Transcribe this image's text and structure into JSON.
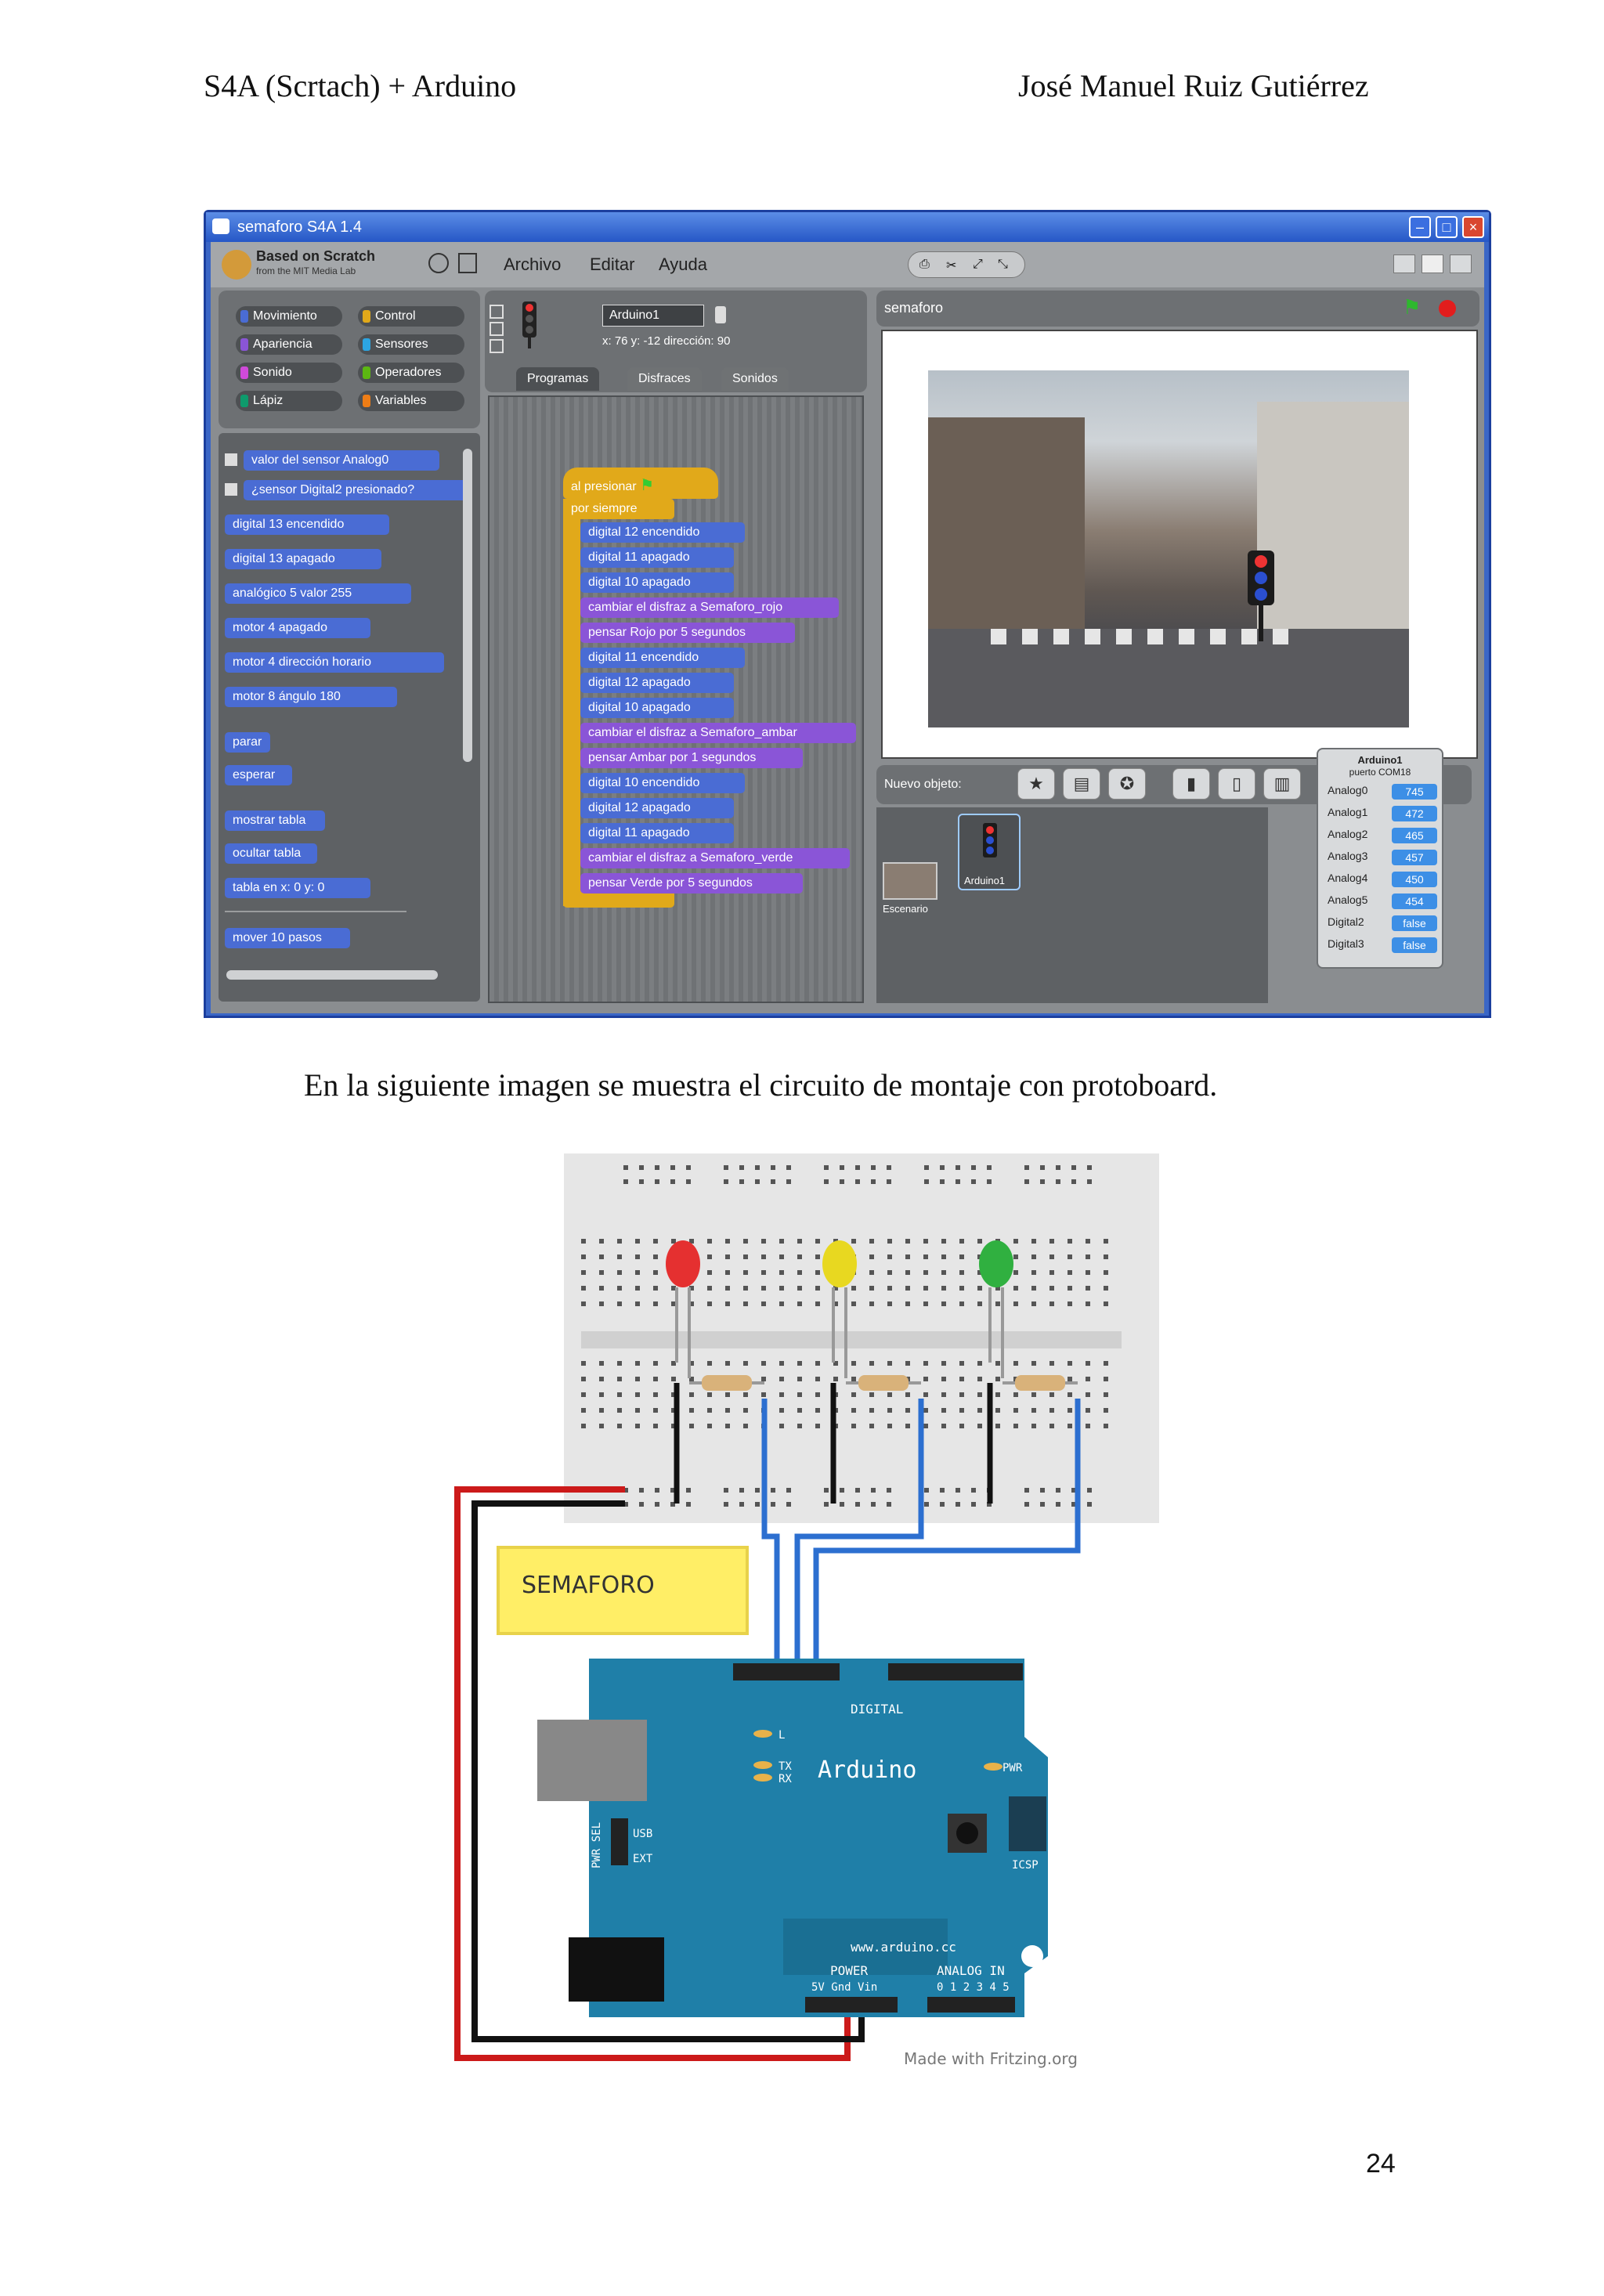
{
  "header": {
    "left": "S4A (Scrtach) + Arduino",
    "right": "José Manuel Ruiz Gutiérrez"
  },
  "page_number": "24",
  "caption": "En la siguiente imagen se muestra el circuito de montaje con protoboard.",
  "s4a_window": {
    "title": "semaforo  S4A 1.4",
    "logo_line1": "Based on Scratch",
    "logo_line2": "from the MIT Media Lab",
    "menu": [
      "Archivo",
      "Editar",
      "Ayuda"
    ],
    "categories": [
      "Movimiento",
      "Control",
      "Apariencia",
      "Sensores",
      "Sonido",
      "Operadores",
      "Lápiz",
      "Variables"
    ],
    "sprite_name": "Arduino1",
    "sprite_coords": "x: 76   y: -12   dirección: 90",
    "tabs": [
      "Programas",
      "Disfraces",
      "Sonidos"
    ],
    "stage_name": "semaforo",
    "sprite_bar_label": "Nuevo objeto:",
    "sprite_thumbs": [
      "Escenario",
      "Arduino1"
    ],
    "palette_blocks": [
      "valor del sensor Analog0",
      "¿sensor Digital2 presionado?",
      "digital 13 encendido",
      "digital 13 apagado",
      "analógico 5 valor 255",
      "motor 4 apagado",
      "motor 4 dirección horario",
      "motor 8 ángulo 180",
      "parar",
      "esperar",
      "mostrar tabla",
      "ocultar tabla",
      "tabla en x: 0 y: 0",
      "mover 10 pasos"
    ],
    "script": [
      "al presionar",
      "por siempre",
      "digital 12 encendido",
      "digital 11 apagado",
      "digital 10 apagado",
      "cambiar el disfraz a Semaforo_rojo",
      "pensar Rojo por 5 segundos",
      "digital 11 encendido",
      "digital 12 apagado",
      "digital 10 apagado",
      "cambiar el disfraz a Semaforo_ambar",
      "pensar Ambar por 1 segundos",
      "digital 10 encendido",
      "digital 12 apagado",
      "digital 11 apagado",
      "cambiar el disfraz a Semaforo_verde",
      "pensar Verde por 5 segundos"
    ],
    "sensor_board": {
      "title": "Arduino1",
      "subtitle": "puerto COM18",
      "rows": [
        {
          "label": "Analog0",
          "value": "745"
        },
        {
          "label": "Analog1",
          "value": "472"
        },
        {
          "label": "Analog2",
          "value": "465"
        },
        {
          "label": "Analog3",
          "value": "457"
        },
        {
          "label": "Analog4",
          "value": "450"
        },
        {
          "label": "Analog5",
          "value": "454"
        },
        {
          "label": "Digital2",
          "value": "false"
        },
        {
          "label": "Digital3",
          "value": "false"
        }
      ]
    }
  },
  "circuit": {
    "note_label": "SEMAFORO",
    "board_name": "Arduino",
    "digital_label": "DIGITAL",
    "website": "www.arduino.cc",
    "power_label": "POWER",
    "analog_label": "ANALOG IN",
    "power_pins": "5V Gnd Vin",
    "analog_pins": "0 1 2 3 4 5",
    "pwr_sel_label": "PWR SEL",
    "usb_label": "USB",
    "ext_label": "EXT",
    "pwr_led_label": "PWR",
    "icsp_label": "ICSP",
    "l_label": "L",
    "tx_label": "TX",
    "rx_label": "RX",
    "fritzing_credit": "Made with Fritzing.org",
    "led_colors": [
      "#e53030",
      "#e8d820",
      "#30b040"
    ]
  }
}
